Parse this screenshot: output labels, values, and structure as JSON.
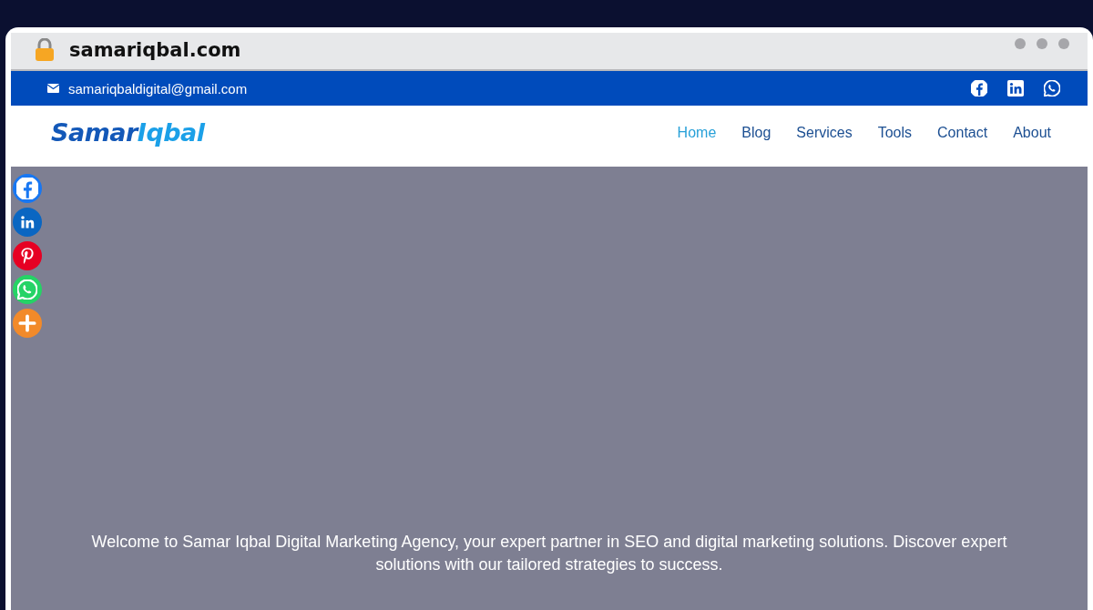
{
  "browser": {
    "url": "samariqbal.com"
  },
  "top_bar": {
    "email": "samariqbaldigital@gmail.com",
    "social": [
      {
        "kind": "facebook"
      },
      {
        "kind": "linkedin"
      },
      {
        "kind": "whatsapp"
      }
    ]
  },
  "header": {
    "logo": {
      "part_1": "Samar",
      "part_2": "Iqbal"
    },
    "nav": [
      {
        "label": "Home",
        "selected": true
      },
      {
        "label": "Blog",
        "selected": false
      },
      {
        "label": "Services",
        "selected": false
      },
      {
        "label": "Tools",
        "selected": false
      },
      {
        "label": "Contact",
        "selected": false
      },
      {
        "label": "About",
        "selected": false
      }
    ]
  },
  "share_bar": [
    {
      "kind": "facebook"
    },
    {
      "kind": "linkedin"
    },
    {
      "kind": "pinterest"
    },
    {
      "kind": "whatsapp"
    },
    {
      "kind": "more"
    }
  ],
  "hero": {
    "text": "Welcome to Samar Iqbal Digital Marketing Agency, your expert partner in SEO and digital marketing solutions. Discover expert solutions with our tailored strategies to success."
  }
}
